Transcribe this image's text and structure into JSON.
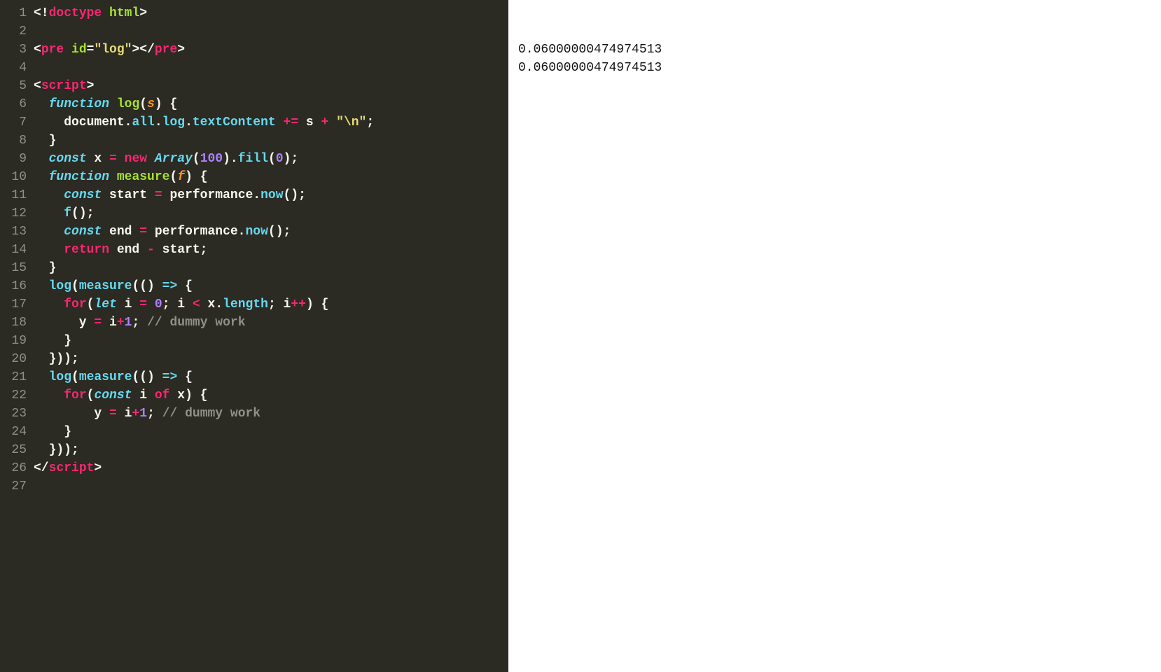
{
  "editor": {
    "lines": [
      {
        "num": 1,
        "tokens": [
          {
            "c": "t-plain",
            "t": "<!"
          },
          {
            "c": "t-tag",
            "t": "doctype"
          },
          {
            "c": "t-plain",
            "t": " "
          },
          {
            "c": "t-attr",
            "t": "html"
          },
          {
            "c": "t-plain",
            "t": ">"
          }
        ]
      },
      {
        "num": 2,
        "tokens": []
      },
      {
        "num": 3,
        "tokens": [
          {
            "c": "t-plain",
            "t": "<"
          },
          {
            "c": "t-tag",
            "t": "pre"
          },
          {
            "c": "t-plain",
            "t": " "
          },
          {
            "c": "t-attr",
            "t": "id"
          },
          {
            "c": "t-plain",
            "t": "="
          },
          {
            "c": "t-string",
            "t": "\"log\""
          },
          {
            "c": "t-plain",
            "t": "></"
          },
          {
            "c": "t-tag",
            "t": "pre"
          },
          {
            "c": "t-plain",
            "t": ">"
          }
        ]
      },
      {
        "num": 4,
        "tokens": []
      },
      {
        "num": 5,
        "tokens": [
          {
            "c": "t-plain",
            "t": "<"
          },
          {
            "c": "t-tag",
            "t": "script"
          },
          {
            "c": "t-plain",
            "t": ">"
          }
        ]
      },
      {
        "num": 6,
        "tokens": [
          {
            "c": "t-plain",
            "t": "  "
          },
          {
            "c": "t-storage",
            "t": "function"
          },
          {
            "c": "t-plain",
            "t": " "
          },
          {
            "c": "t-funcname",
            "t": "log"
          },
          {
            "c": "t-plain",
            "t": "("
          },
          {
            "c": "t-param",
            "t": "s"
          },
          {
            "c": "t-plain",
            "t": ") {"
          }
        ]
      },
      {
        "num": 7,
        "tokens": [
          {
            "c": "t-plain",
            "t": "    document."
          },
          {
            "c": "t-prop",
            "t": "all"
          },
          {
            "c": "t-plain",
            "t": "."
          },
          {
            "c": "t-prop",
            "t": "log"
          },
          {
            "c": "t-plain",
            "t": "."
          },
          {
            "c": "t-prop",
            "t": "textContent"
          },
          {
            "c": "t-plain",
            "t": " "
          },
          {
            "c": "t-op",
            "t": "+="
          },
          {
            "c": "t-plain",
            "t": " s "
          },
          {
            "c": "t-op",
            "t": "+"
          },
          {
            "c": "t-plain",
            "t": " "
          },
          {
            "c": "t-string",
            "t": "\"\\n\""
          },
          {
            "c": "t-plain",
            "t": ";"
          }
        ]
      },
      {
        "num": 8,
        "tokens": [
          {
            "c": "t-plain",
            "t": "  }"
          }
        ]
      },
      {
        "num": 9,
        "tokens": [
          {
            "c": "t-plain",
            "t": "  "
          },
          {
            "c": "t-storage",
            "t": "const"
          },
          {
            "c": "t-plain",
            "t": " x "
          },
          {
            "c": "t-op",
            "t": "="
          },
          {
            "c": "t-plain",
            "t": " "
          },
          {
            "c": "t-op",
            "t": "new"
          },
          {
            "c": "t-plain",
            "t": " "
          },
          {
            "c": "t-class",
            "t": "Array"
          },
          {
            "c": "t-plain",
            "t": "("
          },
          {
            "c": "t-number",
            "t": "100"
          },
          {
            "c": "t-plain",
            "t": ")."
          },
          {
            "c": "t-prop",
            "t": "fill"
          },
          {
            "c": "t-plain",
            "t": "("
          },
          {
            "c": "t-number",
            "t": "0"
          },
          {
            "c": "t-plain",
            "t": ");"
          }
        ]
      },
      {
        "num": 10,
        "tokens": [
          {
            "c": "t-plain",
            "t": "  "
          },
          {
            "c": "t-storage",
            "t": "function"
          },
          {
            "c": "t-plain",
            "t": " "
          },
          {
            "c": "t-funcname",
            "t": "measure"
          },
          {
            "c": "t-plain",
            "t": "("
          },
          {
            "c": "t-param",
            "t": "f"
          },
          {
            "c": "t-plain",
            "t": ") {"
          }
        ]
      },
      {
        "num": 11,
        "tokens": [
          {
            "c": "t-plain",
            "t": "    "
          },
          {
            "c": "t-storage",
            "t": "const"
          },
          {
            "c": "t-plain",
            "t": " start "
          },
          {
            "c": "t-op",
            "t": "="
          },
          {
            "c": "t-plain",
            "t": " performance."
          },
          {
            "c": "t-prop",
            "t": "now"
          },
          {
            "c": "t-plain",
            "t": "();"
          }
        ]
      },
      {
        "num": 12,
        "tokens": [
          {
            "c": "t-plain",
            "t": "    "
          },
          {
            "c": "t-prop",
            "t": "f"
          },
          {
            "c": "t-plain",
            "t": "();"
          }
        ]
      },
      {
        "num": 13,
        "tokens": [
          {
            "c": "t-plain",
            "t": "    "
          },
          {
            "c": "t-storage",
            "t": "const"
          },
          {
            "c": "t-plain",
            "t": " end "
          },
          {
            "c": "t-op",
            "t": "="
          },
          {
            "c": "t-plain",
            "t": " performance."
          },
          {
            "c": "t-prop",
            "t": "now"
          },
          {
            "c": "t-plain",
            "t": "();"
          }
        ]
      },
      {
        "num": 14,
        "tokens": [
          {
            "c": "t-plain",
            "t": "    "
          },
          {
            "c": "t-keyword",
            "t": "return"
          },
          {
            "c": "t-plain",
            "t": " end "
          },
          {
            "c": "t-op",
            "t": "-"
          },
          {
            "c": "t-plain",
            "t": " start;"
          }
        ]
      },
      {
        "num": 15,
        "tokens": [
          {
            "c": "t-plain",
            "t": "  }"
          }
        ]
      },
      {
        "num": 16,
        "tokens": [
          {
            "c": "t-plain",
            "t": "  "
          },
          {
            "c": "t-prop",
            "t": "log"
          },
          {
            "c": "t-plain",
            "t": "("
          },
          {
            "c": "t-prop",
            "t": "measure"
          },
          {
            "c": "t-plain",
            "t": "(() "
          },
          {
            "c": "t-storage",
            "t": "=>"
          },
          {
            "c": "t-plain",
            "t": " {"
          }
        ]
      },
      {
        "num": 17,
        "tokens": [
          {
            "c": "t-plain",
            "t": "    "
          },
          {
            "c": "t-keyword",
            "t": "for"
          },
          {
            "c": "t-plain",
            "t": "("
          },
          {
            "c": "t-storage",
            "t": "let"
          },
          {
            "c": "t-plain",
            "t": " i "
          },
          {
            "c": "t-op",
            "t": "="
          },
          {
            "c": "t-plain",
            "t": " "
          },
          {
            "c": "t-number",
            "t": "0"
          },
          {
            "c": "t-plain",
            "t": "; i "
          },
          {
            "c": "t-op",
            "t": "<"
          },
          {
            "c": "t-plain",
            "t": " x."
          },
          {
            "c": "t-prop",
            "t": "length"
          },
          {
            "c": "t-plain",
            "t": "; i"
          },
          {
            "c": "t-op",
            "t": "++"
          },
          {
            "c": "t-plain",
            "t": ") {"
          }
        ]
      },
      {
        "num": 18,
        "tokens": [
          {
            "c": "t-plain",
            "t": "      y "
          },
          {
            "c": "t-op",
            "t": "="
          },
          {
            "c": "t-plain",
            "t": " i"
          },
          {
            "c": "t-op",
            "t": "+"
          },
          {
            "c": "t-number",
            "t": "1"
          },
          {
            "c": "t-plain",
            "t": "; "
          },
          {
            "c": "t-comment",
            "t": "// dummy work"
          }
        ]
      },
      {
        "num": 19,
        "tokens": [
          {
            "c": "t-plain",
            "t": "    }"
          }
        ]
      },
      {
        "num": 20,
        "tokens": [
          {
            "c": "t-plain",
            "t": "  }));"
          }
        ]
      },
      {
        "num": 21,
        "tokens": [
          {
            "c": "t-plain",
            "t": "  "
          },
          {
            "c": "t-prop",
            "t": "log"
          },
          {
            "c": "t-plain",
            "t": "("
          },
          {
            "c": "t-prop",
            "t": "measure"
          },
          {
            "c": "t-plain",
            "t": "(() "
          },
          {
            "c": "t-storage",
            "t": "=>"
          },
          {
            "c": "t-plain",
            "t": " {"
          }
        ]
      },
      {
        "num": 22,
        "tokens": [
          {
            "c": "t-plain",
            "t": "    "
          },
          {
            "c": "t-keyword",
            "t": "for"
          },
          {
            "c": "t-plain",
            "t": "("
          },
          {
            "c": "t-storage",
            "t": "const"
          },
          {
            "c": "t-plain",
            "t": " i "
          },
          {
            "c": "t-keyword",
            "t": "of"
          },
          {
            "c": "t-plain",
            "t": " x) {"
          }
        ]
      },
      {
        "num": 23,
        "tokens": [
          {
            "c": "t-plain",
            "t": "        y "
          },
          {
            "c": "t-op",
            "t": "="
          },
          {
            "c": "t-plain",
            "t": " i"
          },
          {
            "c": "t-op",
            "t": "+"
          },
          {
            "c": "t-number",
            "t": "1"
          },
          {
            "c": "t-plain",
            "t": "; "
          },
          {
            "c": "t-comment",
            "t": "// dummy work"
          }
        ]
      },
      {
        "num": 24,
        "tokens": [
          {
            "c": "t-plain",
            "t": "    }"
          }
        ]
      },
      {
        "num": 25,
        "tokens": [
          {
            "c": "t-plain",
            "t": "  }));"
          }
        ]
      },
      {
        "num": 26,
        "tokens": [
          {
            "c": "t-plain",
            "t": "</"
          },
          {
            "c": "t-tag",
            "t": "script"
          },
          {
            "c": "t-plain",
            "t": ">"
          }
        ]
      },
      {
        "num": 27,
        "tokens": []
      }
    ]
  },
  "output": {
    "lines": [
      "0.06000000474974513",
      "0.06000000474974513"
    ]
  }
}
